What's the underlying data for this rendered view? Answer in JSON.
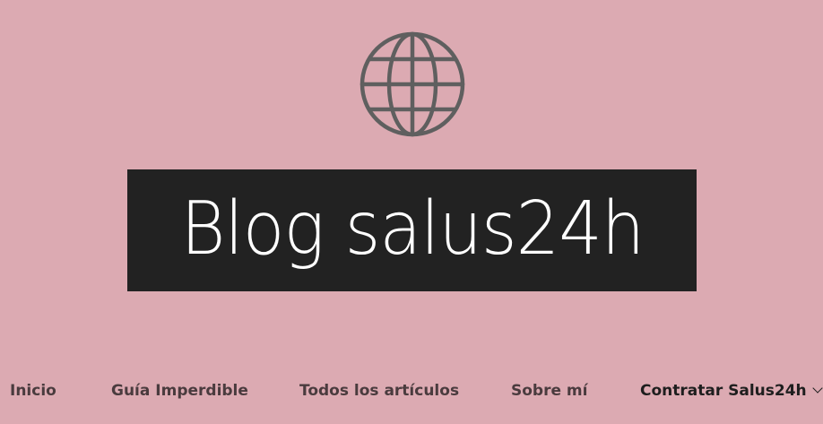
{
  "site": {
    "title": "Blog salus24h"
  },
  "nav": {
    "items": [
      {
        "label": "Inicio"
      },
      {
        "label": "Guía Imperdible"
      },
      {
        "label": "Todos los artículos"
      },
      {
        "label": "Sobre mí"
      },
      {
        "label": "Contratar Salus24h",
        "has_submenu": true
      }
    ]
  },
  "colors": {
    "background": "#dcaab2",
    "title_box": "#222222",
    "title_text": "#ffffff",
    "nav_text": "#4a3b3e",
    "nav_active_text": "#1e1e1e",
    "icon_stroke": "#5f5f5f"
  },
  "icons": {
    "logo": "globe-icon",
    "submenu": "chevron-down-icon"
  }
}
